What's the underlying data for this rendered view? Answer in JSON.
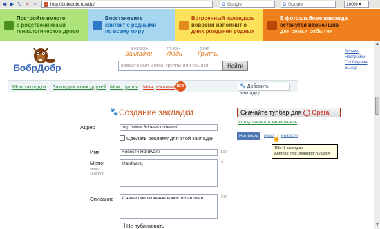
{
  "browser": {
    "url": "http://bobrdobr.ru/add/",
    "search1": "Google",
    "search2": "Google",
    "zoom": "100%"
  },
  "banners": [
    {
      "l1": "Постройте вместе",
      "l2": "с родственниками",
      "l3": "генеалогическое древо"
    },
    {
      "l1": "Восстановите",
      "l2": "контакт с родными",
      "l3": "по всему миру"
    },
    {
      "l1": "Встроенный календарь",
      "l2": "вовремя напомнит о",
      "l3": "днях рождения родных"
    },
    {
      "l1": "В фотоальбоме навсегда",
      "l2": "останутся важнейшие",
      "l3": "для семьи события"
    }
  ],
  "header": {
    "logo": "БобрДобр",
    "stats": [
      {
        "count": "9 000 200+",
        "label": "Закладки"
      },
      {
        "count": "279 900+",
        "label": "Люди"
      },
      {
        "count": "5 842",
        "label": "Группы"
      }
    ],
    "search_placeholder": "введите имя метки, группы или ссылки",
    "search_button": "Найти",
    "account": [
      "3dnews",
      "Настройки",
      "Сообщения",
      "Выход"
    ]
  },
  "menu": {
    "items": [
      "Мои закладки",
      "Закладки моих друзей",
      "Мои группы",
      "Моя реклама"
    ],
    "new_badge": "NEW",
    "add_bookmark": "Добавить закладку"
  },
  "form": {
    "title": "Создание закладки",
    "address_label": "Адрес",
    "address_value": "http://www.3dnews.ru/news/",
    "ad_checkbox": "Сделать рекламу для этой закладки",
    "name_label": "Имя",
    "name_value": "Новости Hardware",
    "name_count": "132",
    "tags_label": "Метки",
    "tags_sub1": "через",
    "tags_sub2": "запятую",
    "tags_value": "Hardware,",
    "tags_count": "9",
    "desc_label": "Описание",
    "desc_value": "Самые оперативные новости hardware",
    "desc_count": "216",
    "private_checkbox": "Не публиковать"
  },
  "side": {
    "toolbar_prefix": "Скачайте тулбар для",
    "toolbar_brand": "Opera",
    "mini_link": "Или установите минипанель",
    "tags": [
      "Hardware",
      "news",
      "новости"
    ],
    "tooltip_line1": "Title: 1 закладок",
    "tooltip_line2": "Address: http://bobrdobr.ru/add/#"
  }
}
